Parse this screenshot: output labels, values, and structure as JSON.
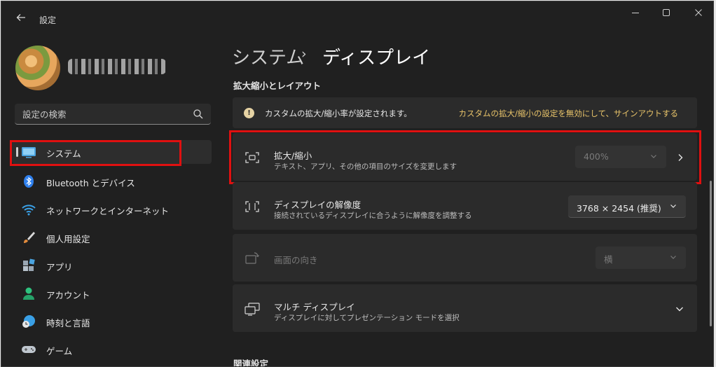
{
  "window": {
    "title": "設定",
    "back_icon": "arrow-left-icon",
    "controls": [
      "minimize-icon",
      "maximize-icon",
      "close-icon"
    ]
  },
  "search": {
    "placeholder": "設定の検索",
    "icon": "search-icon"
  },
  "nav": {
    "items": [
      {
        "label": "システム",
        "icon": "system-icon",
        "selected": true
      },
      {
        "label": "Bluetooth とデバイス",
        "icon": "bluetooth-icon"
      },
      {
        "label": "ネットワークとインターネット",
        "icon": "wifi-icon"
      },
      {
        "label": "個人用設定",
        "icon": "brush-icon"
      },
      {
        "label": "アプリ",
        "icon": "apps-icon"
      },
      {
        "label": "アカウント",
        "icon": "account-icon"
      },
      {
        "label": "時刻と言語",
        "icon": "time-language-icon"
      },
      {
        "label": "ゲーム",
        "icon": "game-controller-icon"
      }
    ]
  },
  "breadcrumb": {
    "parent": "システム",
    "separator": "›",
    "current": "ディスプレイ"
  },
  "section": {
    "title": "拡大縮小とレイアウト"
  },
  "info": {
    "text": "カスタムの拡大/縮小率が設定されます。",
    "link": "カスタムの拡大/縮小の設定を無効にして、サインアウトする"
  },
  "rows": {
    "scale": {
      "title": "拡大/縮小",
      "subtitle": "テキスト、アプリ、その他の項目のサイズを変更します",
      "value": "400%"
    },
    "resolution": {
      "title": "ディスプレイの解像度",
      "subtitle": "接続されているディスプレイに合うように解像度を調整する",
      "value": "3768 × 2454 (推奨)"
    },
    "orientation": {
      "title": "画面の向き",
      "value": "横"
    },
    "multi": {
      "title": "マルチ ディスプレイ",
      "subtitle": "ディスプレイに対してプレゼンテーション モードを選択"
    }
  },
  "related": {
    "title": "関連設定"
  },
  "colors": {
    "highlight": "#e01010",
    "link": "#e9c46a",
    "background": "#202020",
    "card": "#2b2b2b"
  }
}
